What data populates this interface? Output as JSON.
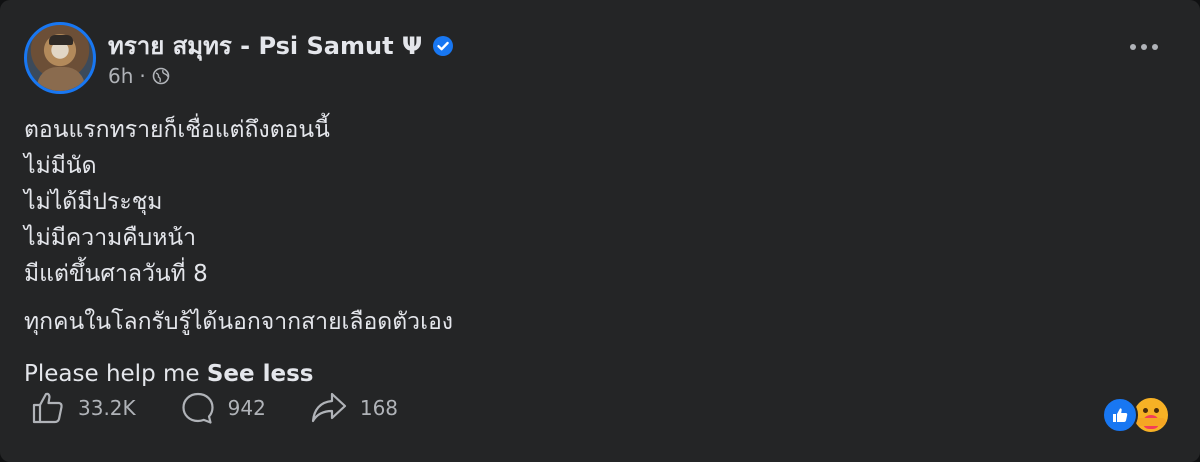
{
  "post": {
    "author": "ทราย สมุทร - Psi Samut Ψ",
    "time": "6h",
    "separator": "·",
    "icons": {
      "verified": "verified-badge-icon",
      "audience": "globe-icon",
      "more": "more-options-icon"
    },
    "text": {
      "lines": [
        "ตอนแรกทรายก็เชื่อแต่ถึงตอนนี้",
        "ไม่มีนัด",
        "ไม่ได้มีประชุม",
        "ไม่มีความคืบหน้า",
        "มีแต่ขึ้นศาลวันที่ 8"
      ],
      "paragraph2": "ทุกคนในโลกรับรู้ได้นอกจากสายเลือดตัวเอง",
      "paragraph3": "Please help me",
      "see_less": "See less"
    }
  },
  "actions": {
    "likes": "33.2K",
    "comments": "942",
    "shares": "168"
  },
  "reactions": [
    "like-reaction-icon",
    "care-reaction-icon"
  ],
  "colors": {
    "background": "#242526",
    "text_primary": "#e4e6eb",
    "text_secondary": "#b0b3b8",
    "accent": "#1877f2"
  }
}
